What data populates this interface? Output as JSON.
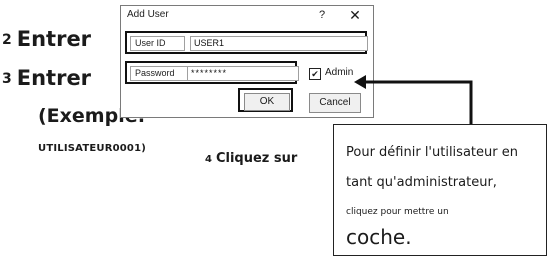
{
  "steps": {
    "step2": {
      "num": "2",
      "text": "Entrer"
    },
    "step3": {
      "num": "3",
      "text": "Entrer"
    },
    "example": "(Exemple:",
    "example_code": "UTILISATEUR0001)",
    "step4": {
      "num": "4",
      "text": "Cliquez sur"
    }
  },
  "dialog": {
    "title": "Add User",
    "help": "?",
    "close": "✕",
    "userid_label": "User ID",
    "userid_value": "USER1",
    "password_label": "Password",
    "password_value": "********",
    "admin_label": "Admin",
    "admin_checked": "✔",
    "ok_label": "OK",
    "cancel_label": "Cancel"
  },
  "callout": {
    "line1": "Pour définir l'utilisateur en",
    "line2": "tant qu'administrateur,",
    "line3": "cliquez pour mettre un",
    "line4": "coche."
  }
}
